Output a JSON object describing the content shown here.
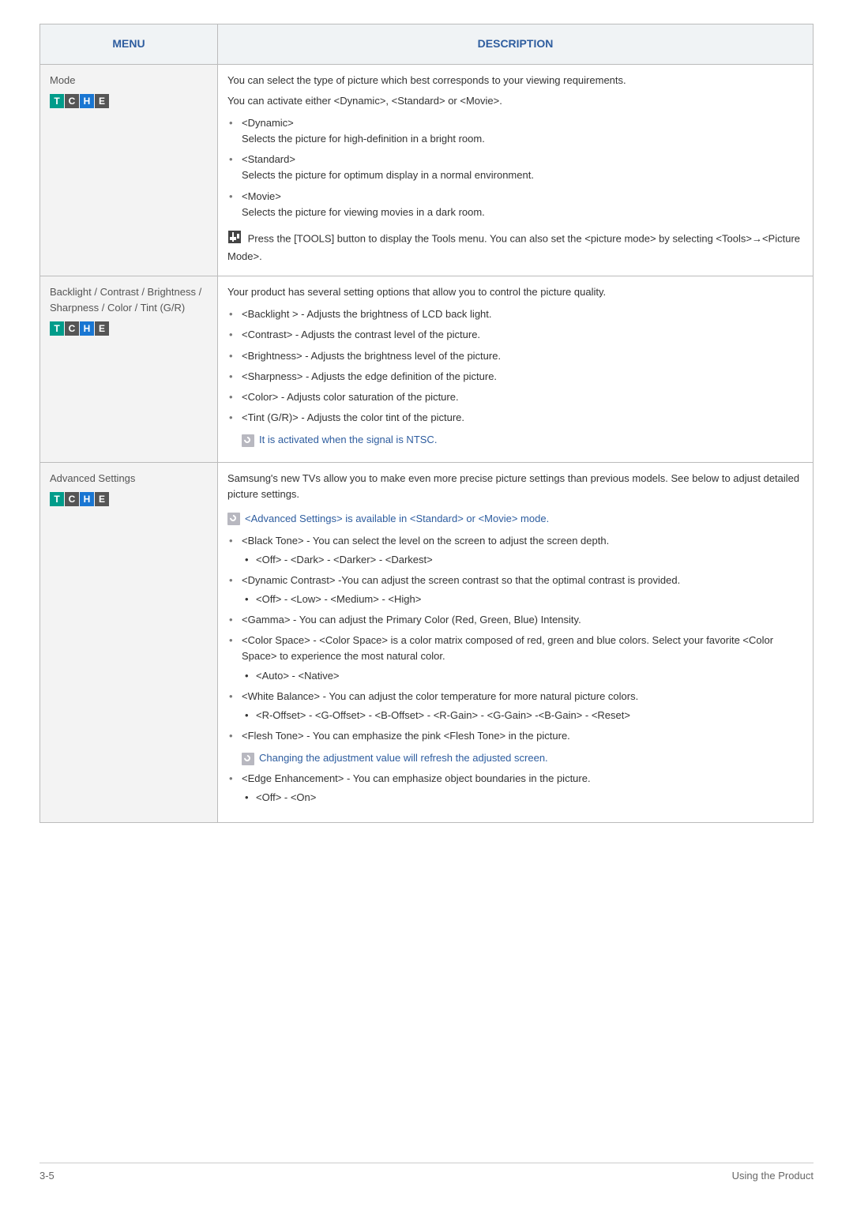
{
  "header": {
    "menu": "MENU",
    "description": "DESCRIPTION"
  },
  "row1": {
    "title": "Mode",
    "p1": "You can select the type of picture which best corresponds to your viewing requirements.",
    "p2": "You can activate either <Dynamic>, <Standard> or <Movie>.",
    "opt1a": "<Dynamic>",
    "opt1b": "Selects the picture for high-definition in a bright room.",
    "opt2a": "<Standard>",
    "opt2b": "Selects the picture for optimum display in a normal environment.",
    "opt3a": "<Movie>",
    "opt3b": "Selects the picture for viewing movies in a dark room.",
    "tools": " Press the [TOOLS] button to display the Tools menu. You can also set the <picture mode> by selecting <Tools>→<Picture Mode>."
  },
  "row2": {
    "title": "Backlight / Contrast / Brightness / Sharpness / Color / Tint (G/R)",
    "p1": "Your product has several setting options that allow you to control the picture quality.",
    "b1": "<Backlight > - Adjusts the brightness of LCD back light.",
    "b2": "<Contrast> - Adjusts the contrast level of the picture.",
    "b3": "<Brightness> - Adjusts the brightness level of the picture.",
    "b4": "<Sharpness> - Adjusts the edge definition of the picture.",
    "b5": "<Color> - Adjusts color saturation of the picture.",
    "b6": "<Tint (G/R)> - Adjusts the color tint of the picture.",
    "note": "It is activated when the signal is NTSC."
  },
  "row3": {
    "title": "Advanced Settings",
    "p1": "Samsung's new TVs allow you to make even more precise picture settings than previous models. See below to adjust detailed picture settings.",
    "note1": "<Advanced Settings> is available in <Standard> or <Movie> mode.",
    "o1": "<Black Tone> - You can select the level on the screen to adjust the screen depth.",
    "o1s": "<Off> - <Dark> - <Darker> - <Darkest>",
    "o2": "<Dynamic Contrast>  -You can adjust the screen contrast so that the optimal contrast is provided.",
    "o2s": "<Off> - <Low> - <Medium> - <High>",
    "o3": "<Gamma> - You can adjust the Primary Color (Red, Green, Blue) Intensity.",
    "o4": "<Color Space> -  <Color Space> is a color matrix composed of red, green and blue colors. Select your favorite <Color Space> to experience the most natural color.",
    "o4s": "<Auto> - <Native>",
    "o5": "<White Balance> - You can adjust the color temperature for more natural picture colors.",
    "o5s": "<R-Offset> - <G-Offset> - <B-Offset> - <R-Gain> - <G-Gain> -<B-Gain> - <Reset>",
    "o6": "<Flesh Tone> - You can emphasize the pink <Flesh Tone> in the picture.",
    "note2": "Changing the adjustment value will refresh the adjusted screen.",
    "o7": "<Edge Enhancement> -   You can emphasize object boundaries in the picture.",
    "o7s": "<Off> - <On>"
  },
  "badges": {
    "T": "T",
    "C": "C",
    "H": "H",
    "E": "E"
  },
  "footer": {
    "left": "3-5",
    "right": "Using the Product"
  }
}
